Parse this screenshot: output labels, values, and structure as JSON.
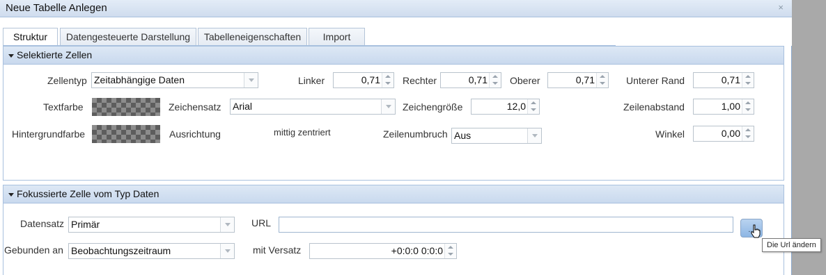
{
  "window": {
    "title": "Neue Tabelle Anlegen",
    "close_glyph": "×"
  },
  "tabs": [
    {
      "label": "Struktur",
      "active": true
    },
    {
      "label": "Datengesteuerte Darstellung",
      "active": false
    },
    {
      "label": "Tabelleneigenschaften",
      "active": false
    },
    {
      "label": "Import",
      "active": false
    }
  ],
  "selected_cells": {
    "header": "Selektierte Zellen",
    "cell_type": {
      "label": "Zellentyp",
      "value": "Zeitabhängige Daten"
    },
    "margin_left": {
      "label": "Linker",
      "value": "0,71"
    },
    "margin_right": {
      "label": "Rechter",
      "value": "0,71"
    },
    "margin_top": {
      "label": "Oberer",
      "value": "0,71"
    },
    "margin_bottom": {
      "label": "Unterer Rand",
      "value": "0,71"
    },
    "text_color": {
      "label": "Textfarbe"
    },
    "font": {
      "label": "Zeichensatz",
      "value": "Arial"
    },
    "font_size": {
      "label": "Zeichengröße",
      "value": "12,0"
    },
    "line_spacing": {
      "label": "Zeilenabstand",
      "value": "1,00"
    },
    "background_color": {
      "label": "Hintergrundfarbe"
    },
    "alignment": {
      "label": "Ausrichtung",
      "value": "mittig zentriert"
    },
    "line_wrap": {
      "label": "Zeilenumbruch",
      "value": "Aus"
    },
    "angle": {
      "label": "Winkel",
      "value": "0,00"
    }
  },
  "focused_cell": {
    "header": "Fokussierte Zelle vom Typ Daten",
    "dataset": {
      "label": "Datensatz",
      "value": "Primär"
    },
    "url": {
      "label": "URL",
      "value": ""
    },
    "url_button_label": "...",
    "bound_to": {
      "label": "Gebunden an",
      "value": "Beobachtungszeitraum"
    },
    "offset": {
      "label": "mit Versatz",
      "value": "+0:0:0 0:0:0"
    }
  },
  "tooltip": "Die Url ändern",
  "colors": {
    "header_gradient_top": "#dde8f5",
    "header_gradient_bottom": "#c9d9ee",
    "border": "#a8c0de",
    "button_blue": "#8db6e4",
    "desktop_gray": "#a9a9a9"
  },
  "icons": {
    "close": "close-icon",
    "collapse": "caret-down-icon",
    "mouse_cursor": "hand-pointer-icon",
    "dropdown": "chevron-down-icon",
    "spinner": "spinner-arrows-icon"
  }
}
